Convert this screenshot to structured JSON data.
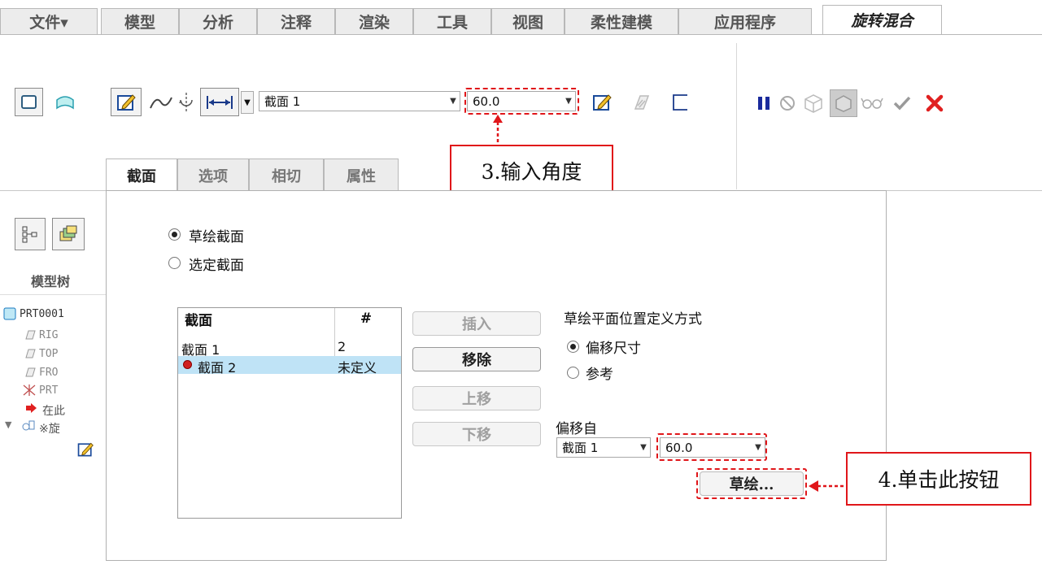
{
  "menu": {
    "tabs": [
      {
        "label": "文件▾"
      },
      {
        "label": "模型"
      },
      {
        "label": "分析"
      },
      {
        "label": "注释"
      },
      {
        "label": "渲染"
      },
      {
        "label": "工具"
      },
      {
        "label": "视图"
      },
      {
        "label": "柔性建模"
      },
      {
        "label": "应用程序"
      },
      {
        "label": "旋转混合"
      }
    ]
  },
  "ribbon": {
    "section_combo": {
      "value": "截面 1"
    },
    "angle_combo": {
      "value": "60.0"
    }
  },
  "callouts": {
    "step3": "3.输入角度",
    "step4": "4.单击此按钮"
  },
  "subtabs": [
    "截面",
    "选项",
    "相切",
    "属性"
  ],
  "left_panel": {
    "title": "模型树",
    "items": [
      "PRT0001",
      "RIG",
      "TOP",
      "FRO",
      "PRT",
      "在此",
      "※旋"
    ]
  },
  "section_panel": {
    "radio_sketched": "草绘截面",
    "radio_selected": "选定截面",
    "table": {
      "headers": [
        "截面",
        "#"
      ],
      "rows": [
        {
          "name": "截面 1",
          "value": "2"
        },
        {
          "name": "截面 2",
          "value": "未定义"
        }
      ]
    },
    "buttons": {
      "insert": "插入",
      "remove": "移除",
      "move_up": "上移",
      "move_down": "下移"
    },
    "plane_def_label": "草绘平面位置定义方式",
    "radio_offset": "偏移尺寸",
    "radio_reference": "参考",
    "offset_from_label": "偏移自",
    "offset_from_combo": "截面 1",
    "offset_value_combo": "60.0",
    "sketch_button": "草绘..."
  },
  "colors": {
    "annotation_red": "#e0161a",
    "selected_row": "#bfe3f6",
    "pause_blue": "#1a2a9c",
    "close_red": "#e02020",
    "check_green": "#8a8a8a"
  }
}
